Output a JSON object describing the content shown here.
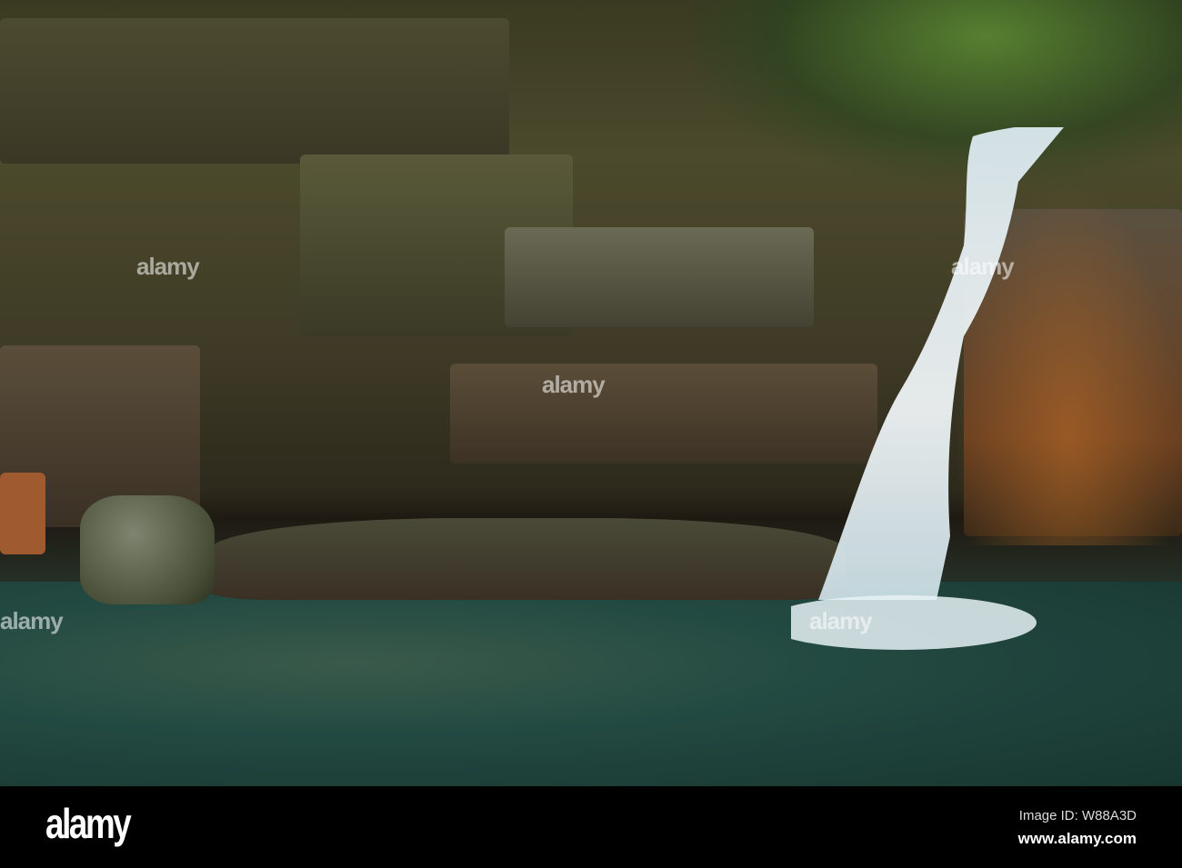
{
  "photo": {
    "subject": "waterfall-pool",
    "watermark": "alamy"
  },
  "footer": {
    "logo": "alamy",
    "image_id": "Image ID: W88A3D",
    "url": "www.alamy.com"
  }
}
